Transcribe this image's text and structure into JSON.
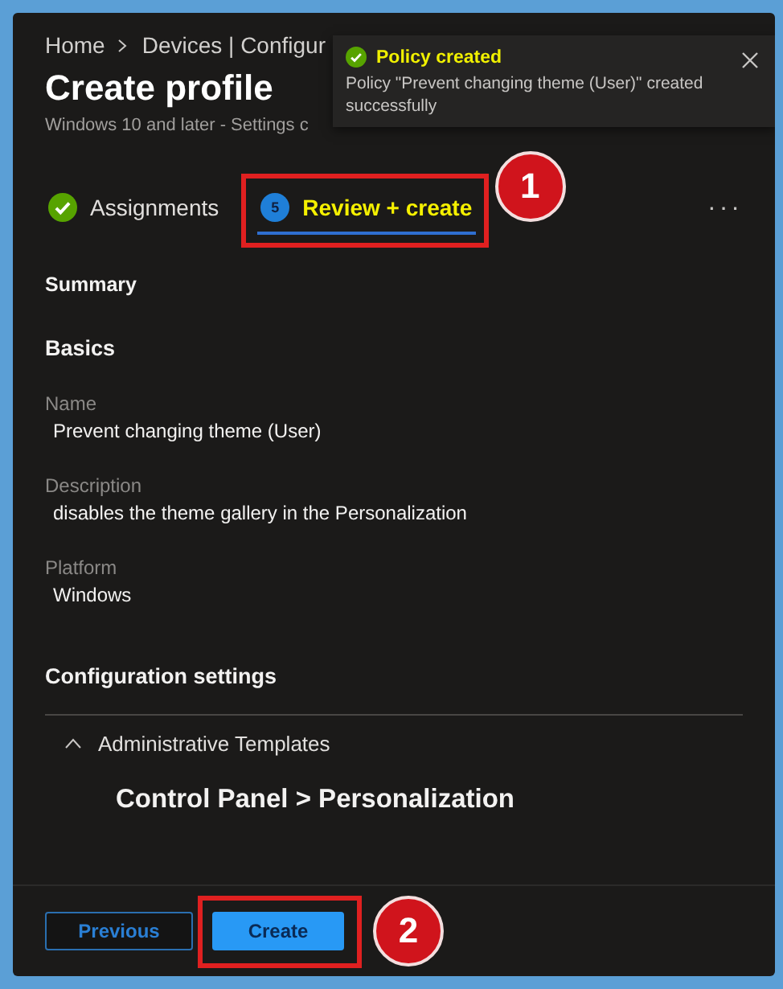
{
  "breadcrumb": [
    {
      "label": "Home"
    },
    {
      "label": "Devices | Configur"
    }
  ],
  "title": "Create profile",
  "subtitle": "Windows 10 and later - Settings c",
  "toast": {
    "title": "Policy created",
    "message": "Policy \"Prevent changing theme (User)\" created successfully"
  },
  "tabs": [
    {
      "kind": "done",
      "label": "Assignments",
      "selected": false
    },
    {
      "kind": "step",
      "step": "5",
      "label": "Review + create",
      "selected": true,
      "callout": "1"
    }
  ],
  "more": "···",
  "summary_heading": "Summary",
  "basics_heading": "Basics",
  "fields": [
    {
      "label": "Name",
      "value": "Prevent changing theme (User)"
    },
    {
      "label": "Description",
      "value": "disables the theme gallery in the Personalization"
    },
    {
      "label": "Platform",
      "value": "Windows"
    }
  ],
  "config_heading": "Configuration settings",
  "group": {
    "label": "Administrative Templates",
    "expanded": true
  },
  "category": "Control Panel > Personalization",
  "buttons": [
    {
      "label": "Previous",
      "kind": "secondary"
    },
    {
      "label": "Create",
      "kind": "primary",
      "callout": "2"
    }
  ]
}
